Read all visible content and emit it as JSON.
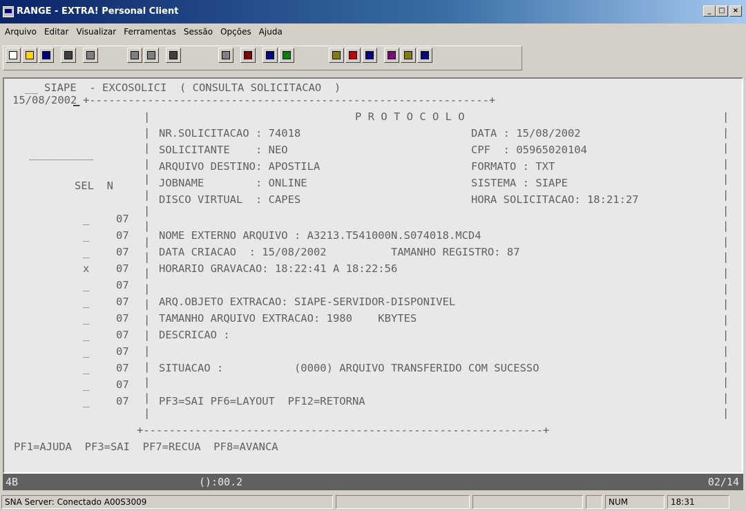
{
  "window": {
    "title": "RANGE - EXTRA! Personal Client",
    "minimize_glyph": "_",
    "maximize_glyph": "□",
    "close_glyph": "×"
  },
  "menu": [
    "Arquivo",
    "Editar",
    "Visualizar",
    "Ferramentas",
    "Sessão",
    "Opções",
    "Ajuda"
  ],
  "toolbar": {
    "icons": [
      "new-icon",
      "open-icon",
      "save-icon",
      "print-icon",
      "cut-icon",
      "copy-icon",
      "paste-icon",
      "connect-icon",
      "send-icon",
      "tools-icon",
      "record-icon",
      "stop-icon",
      "macro-icon",
      "palette-icon",
      "edit-icon",
      "settings-icon",
      "signature-icon",
      "help-icon"
    ]
  },
  "terminal": {
    "header_line1": "__ SIAPE  - EXCOSOLICI  ( CONSULTA SOLICITACAO  )",
    "header_date": "15/08/2002",
    "cursor": "_",
    "box_top": "+--------------------------------------------------------------+",
    "protocol_title": "P R O T O C O L O",
    "fields": [
      {
        "left": "NR.SOLICITACAO : 74018",
        "right": "DATA : 15/08/2002"
      },
      {
        "left": "SOLICITANTE    : NEO",
        "right": "CPF  : 05965020104"
      },
      {
        "left": "ARQUIVO DESTINO: APOSTILA",
        "right": "FORMATO : TXT"
      },
      {
        "left": "JOBNAME        : ONLINE",
        "right": "SISTEMA : SIAPE"
      },
      {
        "left": "DISCO VIRTUAL  : CAPES",
        "right": "HORA SOLICITACAO: 18:21:27"
      }
    ],
    "underline": "__________",
    "sel_header": "SEL  N",
    "rows": [
      {
        "sel": "_",
        "n": "07",
        "text": ""
      },
      {
        "sel": "_",
        "n": "07",
        "text": "NOME EXTERNO ARQUIVO : A3213.T541000N.S074018.MCD4"
      },
      {
        "sel": "_",
        "n": "07",
        "text": "DATA CRIACAO  : 15/08/2002          TAMANHO REGISTRO: 87"
      },
      {
        "sel": "x",
        "n": "07",
        "text": "HORARIO GRAVACAO: 18:22:41 A 18:22:56"
      },
      {
        "sel": "_",
        "n": "07",
        "text": ""
      },
      {
        "sel": "_",
        "n": "07",
        "text": "ARQ.OBJETO EXTRACAO: SIAPE-SERVIDOR-DISPONIVEL"
      },
      {
        "sel": "_",
        "n": "07",
        "text": "TAMANHO ARQUIVO EXTRACAO: 1980    KBYTES"
      },
      {
        "sel": "_",
        "n": "07",
        "text": "DESCRICAO :"
      },
      {
        "sel": "_",
        "n": "07",
        "text": ""
      },
      {
        "sel": "_",
        "n": "07",
        "text": "SITUACAO :           (0000) ARQUIVO TRANSFERIDO COM SUCESSO"
      },
      {
        "sel": "_",
        "n": "07",
        "text": ""
      },
      {
        "sel": "_",
        "n": "07",
        "text": "PF3=SAI PF6=LAYOUT  PF12=RETORNA"
      }
    ],
    "box_bottom": "+--------------------------------------------------------------+",
    "pf_keys": "PF1=AJUDA  PF3=SAI  PF7=RECUA  PF8=AVANCA"
  },
  "oia": {
    "left": "4B",
    "middle": "():00.2",
    "right": "02/14"
  },
  "statusbar": {
    "connection": "SNA Server: Conectado A00S3009",
    "num": "NUM",
    "time": "18:31"
  }
}
